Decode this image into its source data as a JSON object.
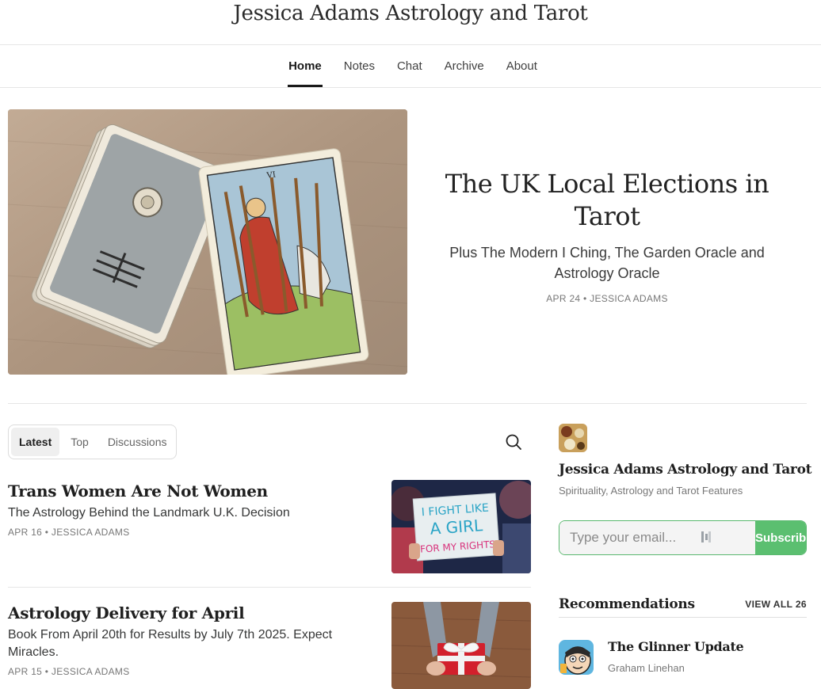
{
  "site": {
    "title": "Jessica Adams Astrology and Tarot"
  },
  "nav": {
    "items": [
      {
        "label": "Home",
        "active": true
      },
      {
        "label": "Notes"
      },
      {
        "label": "Chat"
      },
      {
        "label": "Archive"
      },
      {
        "label": "About"
      }
    ]
  },
  "hero": {
    "title": "The UK Local Elections in Tarot",
    "subtitle": "Plus The Modern I Ching, The Garden Oracle and Astrology Oracle",
    "meta": "APR 24 • JESSICA ADAMS",
    "card_numeral": "VI"
  },
  "tabs": [
    {
      "label": "Latest",
      "active": true
    },
    {
      "label": "Top"
    },
    {
      "label": "Discussions"
    }
  ],
  "posts": [
    {
      "title": "Trans Women Are Not Women",
      "subtitle": "The Astrology Behind the Landmark U.K. Decision",
      "meta": "APR 16 • JESSICA ADAMS",
      "sign_text": [
        "I FIGHT LIKE",
        "A GIRL",
        "FOR MY RIGHTS"
      ]
    },
    {
      "title": "Astrology Delivery for April",
      "subtitle": "Book From April 20th for Results by July 7th 2025. Expect Miracles.",
      "meta": "APR 15 • JESSICA ADAMS"
    }
  ],
  "sidebar": {
    "pub_name": "Jessica Adams Astrology and Tarot",
    "pub_desc": "Spirituality, Astrology and Tarot Features",
    "email_placeholder": "Type your email...",
    "subscribe_label": "Subscribe",
    "recommendations_title": "Recommendations",
    "view_all": "VIEW ALL 26",
    "rec": {
      "name": "The Glinner Update",
      "author": "Graham Linehan"
    }
  },
  "colors": {
    "accent": "#5bbf70",
    "text": "#363737",
    "meta": "#777777"
  }
}
